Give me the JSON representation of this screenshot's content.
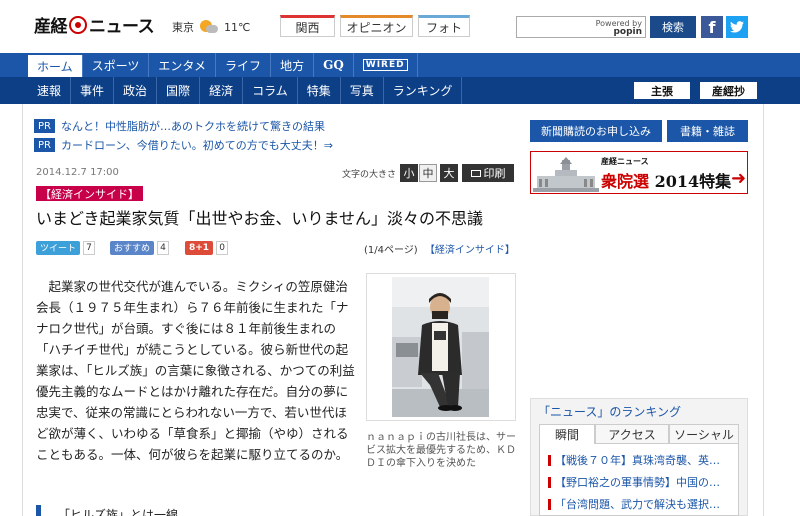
{
  "header": {
    "logo_text_left": "産経",
    "logo_text_right": "ニュース",
    "weather_city": "東京",
    "weather_icon": "sun-cloud-icon",
    "weather_temp": "11℃",
    "tabs": [
      "関西",
      "オピニオン",
      "フォト"
    ],
    "search_placeholder": "",
    "powered_by": "Powered by",
    "popin": "popin",
    "search_button": "検索",
    "facebook": "f",
    "twitter": "t"
  },
  "nav_primary": [
    "ホーム",
    "スポーツ",
    "エンタメ",
    "ライフ",
    "地方",
    "GQ",
    "WIRED"
  ],
  "nav_secondary": [
    "速報",
    "事件",
    "政治",
    "国際",
    "経済",
    "コラム",
    "特集",
    "写真",
    "ランキング"
  ],
  "nav_buttons": {
    "shucho": "主張",
    "sankeisho": "産經抄"
  },
  "pr": [
    {
      "badge": "PR",
      "text": "なんと！中性脂肪が…あのトクホを続けて驚きの結果"
    },
    {
      "badge": "PR",
      "text": "カードローン、今借りたい。初めての方でも大丈夫！⇒"
    }
  ],
  "article": {
    "date": "2014.12.7 17:00",
    "font_size_label": "文字の大きさ",
    "font_sizes": [
      "小",
      "中",
      "大"
    ],
    "print_label": "印刷",
    "category": "【経済インサイド】",
    "headline": "いまどき起業家気質「出世やお金、いりません」淡々の不思議",
    "social": {
      "tweet_label": "ツイート",
      "tweet_count": "7",
      "osusume_label": "おすすめ",
      "osusume_count": "4",
      "gplus_label": "8+1",
      "gplus_count": "0"
    },
    "page_info": "(1/4ページ)",
    "page_link": "【経済インサイド】",
    "body": "　起業家の世代交代が進んでいる。ミクシィの笠原健治会長（１９７５年生まれ）ら７６年前後に生まれた「ナナロク世代」が台頭。すぐ後には８１年前後生まれの「ハチイチ世代」が続こうとしている。彼ら新世代の起業家は、「ヒルズ族」の言葉に象徴される、かつての利益優先主義的なムードとはかけ離れた存在だ。自分の夢に忠実で、従来の常識にとらわれない一方で、若い世代ほど欲が薄く、いわゆる「草食系」と揶揄（やゆ）されることもある。一体、何が彼らを起業に駆り立てるのか。",
    "photo_caption": "ｎａｎａｐｉの古川社長は、サービス拡大を最優先するため、ＫＤＤＩの傘下入りを決めた",
    "subhead": "「ヒルズ族」とは一線"
  },
  "sidebar": {
    "subscribe_button": "新聞購読のお申し込み",
    "books_button": "書籍・雑誌",
    "election_logo": "産経ニュース",
    "election_title_red": "衆院選",
    "election_title_black": "2014特集",
    "ranking_title": "「ニュース」のランキング",
    "ranking_tabs": [
      "瞬間",
      "アクセス",
      "ソーシャル"
    ],
    "ranking_items": [
      "【戦後７０年】真珠湾奇襲、英…",
      "【野口裕之の軍事情勢】中国の…",
      "「台湾問題、武力で解決も選択…"
    ]
  },
  "colors": {
    "nav_primary": "#1b56a8",
    "nav_secondary": "#0d3f86",
    "category_tag": "#c8004a",
    "accent_red": "#cc0000"
  }
}
